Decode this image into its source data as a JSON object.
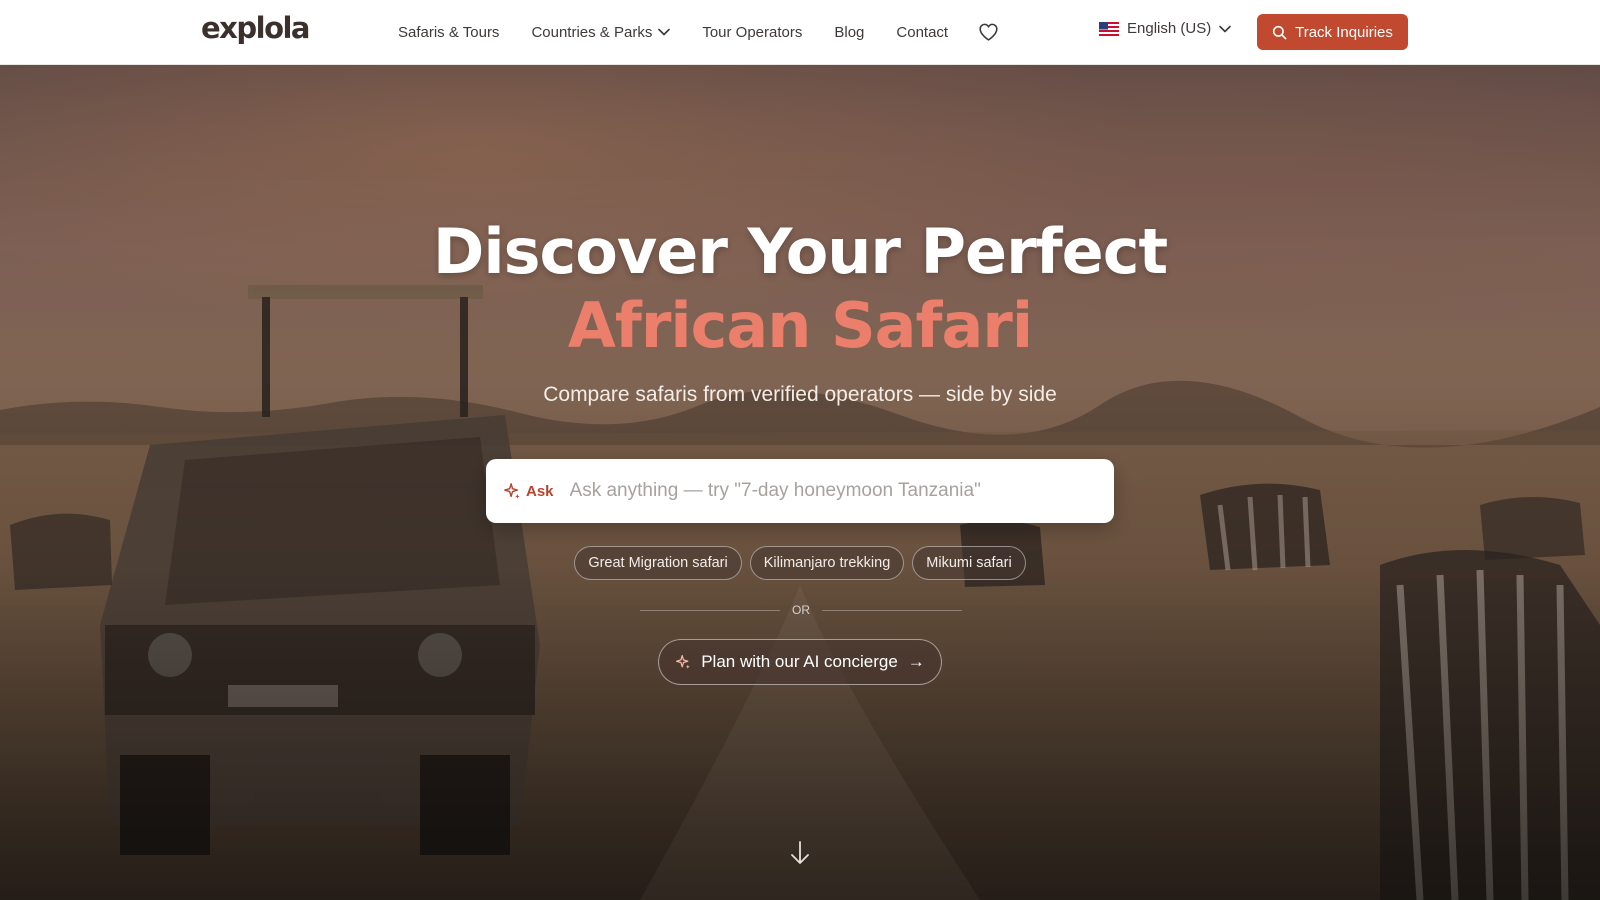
{
  "header": {
    "logo": "explola",
    "nav": [
      {
        "label": "Safaris & Tours",
        "has_dropdown": false
      },
      {
        "label": "Countries & Parks",
        "has_dropdown": true
      },
      {
        "label": "Tour Operators",
        "has_dropdown": false
      },
      {
        "label": "Blog",
        "has_dropdown": false
      },
      {
        "label": "Contact",
        "has_dropdown": false
      }
    ],
    "favorites_icon": "heart-icon",
    "language": {
      "label": "English (US)",
      "flag_icon": "us-flag-icon"
    },
    "track_button": {
      "label": "Track Inquiries",
      "icon": "search-icon"
    }
  },
  "hero": {
    "title_line1": "Discover Your Perfect",
    "title_line2": "African Safari",
    "subtitle": "Compare safaris from verified operators — side by side",
    "search": {
      "ask_label": "Ask",
      "placeholder": "Ask anything — try \"7-day honeymoon Tanzania\"",
      "value": ""
    },
    "suggestions": [
      "Great Migration safari",
      "Kilimanjaro trekking",
      "Mikumi safari"
    ],
    "or_text": "OR",
    "concierge_button": {
      "label": "Plan with our AI concierge",
      "icon": "sparkle-icon",
      "arrow": "→"
    },
    "scroll_icon": "arrow-down-icon"
  },
  "colors": {
    "brand": "#c0492f",
    "accent_title": "#ec7f6b",
    "logo": "#3b302c",
    "nav_text": "#3f3a37"
  }
}
